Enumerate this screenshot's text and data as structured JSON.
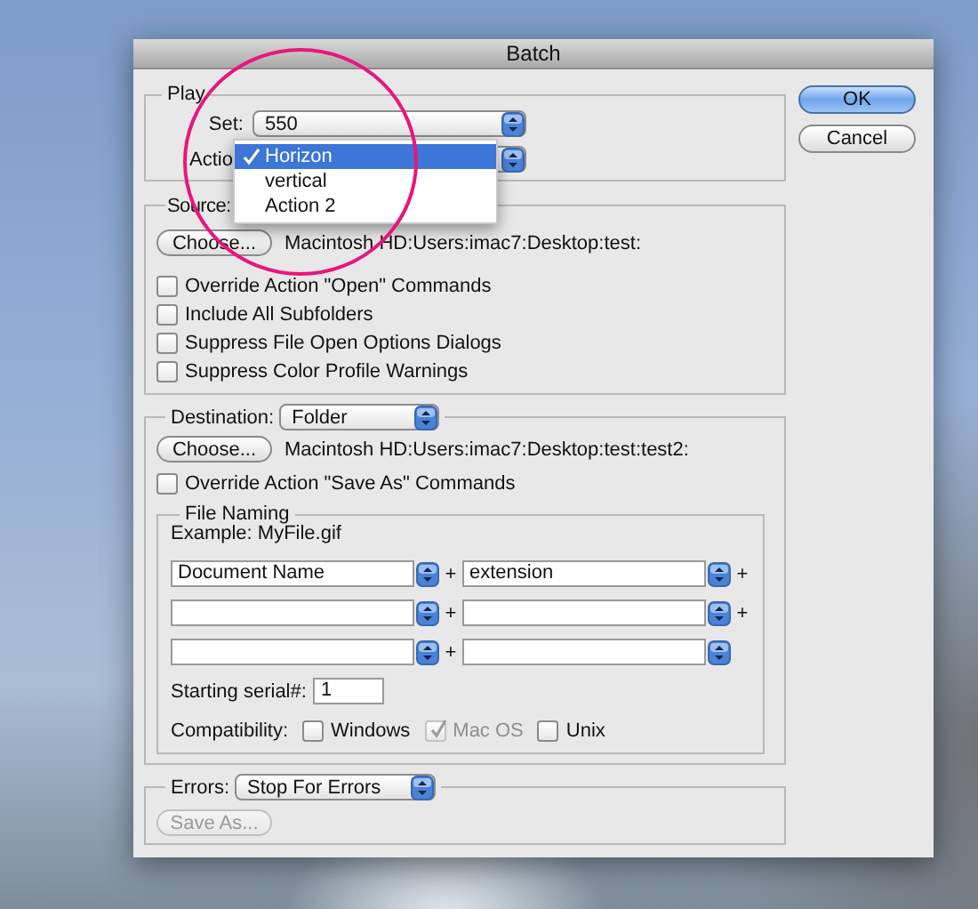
{
  "window": {
    "title": "Batch"
  },
  "play": {
    "title": "Play",
    "set": {
      "label": "Set:",
      "value": "550"
    },
    "action": {
      "label": "Actio"
    },
    "action_menu": [
      {
        "label": "Horizon",
        "selected": true
      },
      {
        "label": "vertical",
        "selected": false
      },
      {
        "label": "Action 2",
        "selected": false
      }
    ]
  },
  "source": {
    "label": "Source:",
    "choose_button": "Choose...",
    "path": "Macintosh HD:Users:imac7:Desktop:test:",
    "options": [
      {
        "label": "Override Action \"Open\" Commands",
        "checked": false
      },
      {
        "label": "Include All Subfolders",
        "checked": false
      },
      {
        "label": "Suppress File Open Options Dialogs",
        "checked": false
      },
      {
        "label": "Suppress Color Profile Warnings",
        "checked": false
      }
    ]
  },
  "destination": {
    "label": "Destination:",
    "value": "Folder",
    "choose_button": "Choose...",
    "path": "Macintosh HD:Users:imac7:Desktop:test:test2:",
    "override": {
      "label": "Override Action \"Save As\" Commands",
      "checked": false
    },
    "file_naming": {
      "title": "File Naming",
      "example": "Example: MyFile.gif",
      "rows": [
        {
          "first": "Document Name",
          "joiner": "+",
          "second": "extension",
          "trailing": "+"
        },
        {
          "joiner": "+",
          "trailing": "+"
        },
        {
          "joiner": "+"
        }
      ],
      "serial": {
        "label": "Starting serial#:",
        "value": "1"
      },
      "compatibility": {
        "label": "Compatibility:",
        "options": [
          {
            "label": "Windows",
            "checked": false,
            "disabled": false
          },
          {
            "label": "Mac OS",
            "checked": true,
            "disabled": true
          },
          {
            "label": "Unix",
            "checked": false,
            "disabled": false
          }
        ]
      }
    }
  },
  "errors": {
    "label": "Errors:",
    "value": "Stop For Errors",
    "save_as": {
      "label": "Save As...",
      "disabled": true
    }
  },
  "buttons": [
    {
      "label": "OK",
      "default": true
    },
    {
      "label": "Cancel",
      "default": false
    }
  ]
}
